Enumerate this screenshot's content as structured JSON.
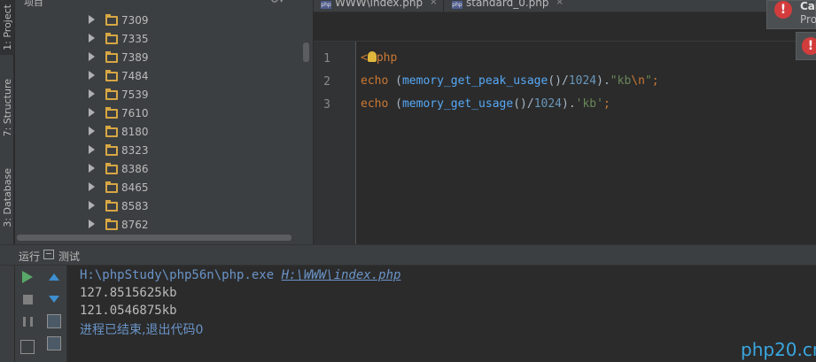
{
  "toolstrip": {
    "tab_project": "1: Project",
    "tab_structure": "7: Structure",
    "tab_database": "3: Database"
  },
  "project": {
    "title": "项目",
    "gear_icon": "gear-icon",
    "folders": [
      "7309",
      "7335",
      "7389",
      "7484",
      "7539",
      "7610",
      "8180",
      "8323",
      "8386",
      "8465",
      "8583",
      "8762"
    ]
  },
  "editor": {
    "tabs": [
      {
        "label": "WWW\\index.php",
        "icon": "php-file-icon"
      },
      {
        "label": "standard_0.php",
        "icon": "php-file-icon"
      }
    ],
    "lines": [
      {
        "no": "1"
      },
      {
        "no": "2"
      },
      {
        "no": "3"
      }
    ],
    "code": {
      "l1_open": "<",
      "l1_php": "php",
      "l2_echo": "echo",
      "l2_open": " (",
      "l2_fn": "memory_get_peak_usage",
      "l2_mid": "()/",
      "l2_num": "1024",
      "l2_close": ").",
      "l2_str1": "\"kb",
      "l2_esc": "\\n",
      "l2_str2": "\"",
      "l2_end": ";",
      "l3_echo": "echo",
      "l3_open": " (",
      "l3_fn": "memory_get_usage",
      "l3_mid": "()/",
      "l3_num": "1024",
      "l3_close": ").",
      "l3_str": "'kb'",
      "l3_end": ";"
    }
  },
  "notification": {
    "title": "Can",
    "body": "Pro",
    "icon": "error-icon"
  },
  "run": {
    "label": "运行",
    "config_name": "测试",
    "console": {
      "cmd_exe": "H:\\phpStudy\\php56n\\php.exe ",
      "cmd_path": "H:\\WWW\\index.php",
      "out1": "127.8515625kb",
      "out2": "121.0546875kb",
      "finished": "进程已结束,退出代码0"
    }
  },
  "watermark": "php20.cn",
  "colors": {
    "bg": "#2b2b2b",
    "panel": "#3c3f41",
    "keyword": "#cc7832",
    "string": "#6a8759",
    "number": "#6897bb",
    "function": "#56a8f5",
    "console_link": "#6a94c8",
    "run_green": "#59a869",
    "folder": "#d7a744",
    "error": "#d33c3c"
  }
}
